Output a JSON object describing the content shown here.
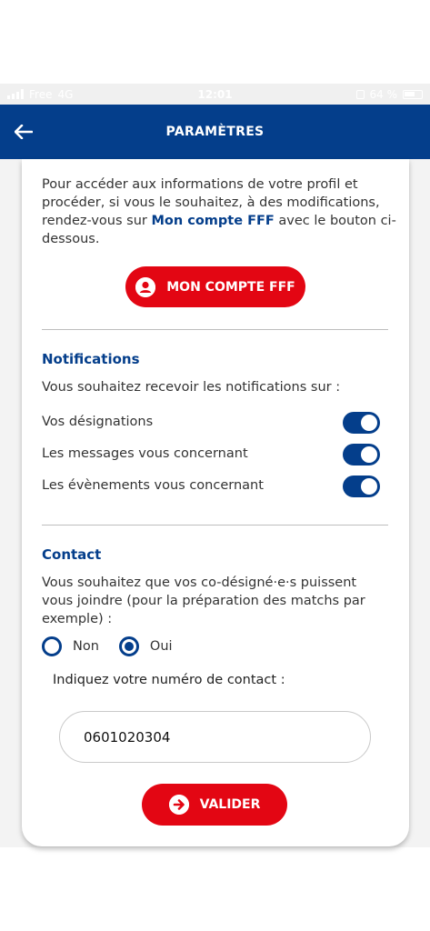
{
  "status_bar": {
    "carrier": "Free",
    "network": "4G",
    "time": "12:01",
    "battery": "64 %"
  },
  "header": {
    "title": "PARAMÈTRES"
  },
  "profile": {
    "intro_text": "Pour accéder aux informations de votre profil et procéder, si vous le souhaitez, à des modifications, rendez-vous sur ",
    "intro_link": "Mon compte FFF",
    "intro_suffix": " avec le bouton ci-dessous.",
    "button_label": "MON COMPTE FFF"
  },
  "notifications": {
    "title": "Notifications",
    "question": "Vous souhaitez recevoir les notifications sur :",
    "items": [
      {
        "label": "Vos désignations",
        "enabled": true
      },
      {
        "label": "Les messages vous concernant",
        "enabled": true
      },
      {
        "label": "Les évènements vous concernant",
        "enabled": true
      }
    ]
  },
  "contact": {
    "title": "Contact",
    "question": "Vous souhaitez que vos co-désigné·e·s puissent vous joindre (pour la préparation des matchs par exemple) :",
    "options": [
      {
        "label": "Non",
        "selected": false
      },
      {
        "label": "Oui",
        "selected": true
      }
    ],
    "phone_label": "Indiquez votre numéro de contact :",
    "phone_value": "0601020304",
    "submit_label": "VALIDER"
  },
  "colors": {
    "primary": "#043e8b",
    "accent": "#e30613"
  }
}
